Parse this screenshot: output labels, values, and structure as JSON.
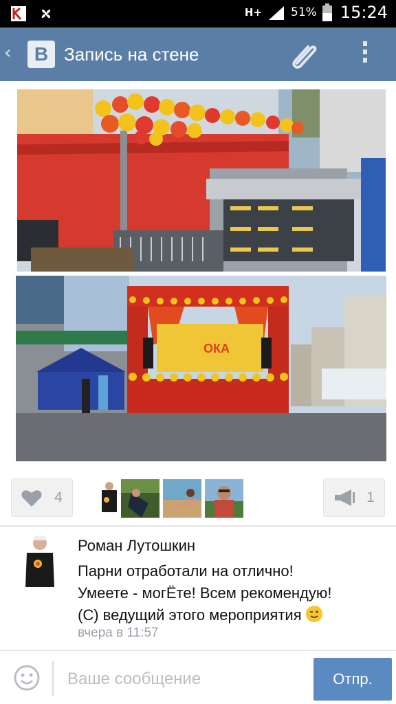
{
  "status_bar": {
    "network": "H+",
    "battery": "51%",
    "time": "15:24"
  },
  "header": {
    "title": "Запись на стене",
    "icons": [
      "back-icon",
      "vk-logo",
      "paperclip-icon",
      "more-icon"
    ],
    "color": "#5b7ea6"
  },
  "photos": [
    {
      "name": "stage-equipment-photo"
    },
    {
      "name": "outdoor-stage-photo",
      "banner_text": "ОКА"
    }
  ],
  "actions": {
    "like_count": "4",
    "share_count": "1"
  },
  "comment": {
    "author": "Роман Лутошкин",
    "lines": [
      "Парни отработали на отлично!",
      "Умеете - могЁте! Всем рекомендую!",
      "(С) ведущий этого мероприятия"
    ],
    "time": "вчера в 11:57"
  },
  "composer": {
    "placeholder": "Ваше сообщение",
    "send_label": "Отпр.",
    "send_color": "#5b89c2"
  }
}
